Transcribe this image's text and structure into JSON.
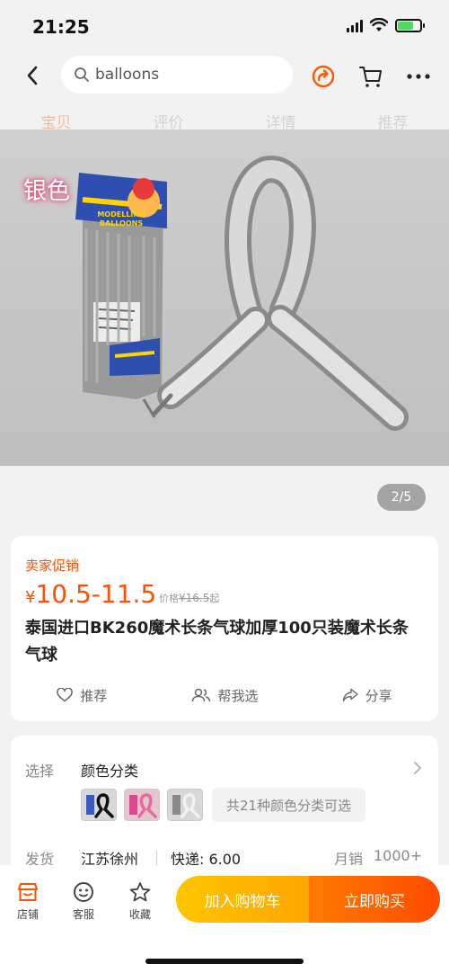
{
  "status_bar": {
    "time": "21:25",
    "battery_level": 0.7
  },
  "search": {
    "query": "balloons"
  },
  "tabs": [
    {
      "label": "宝贝",
      "active": true
    },
    {
      "label": "评价",
      "active": false
    },
    {
      "label": "详情",
      "active": false
    },
    {
      "label": "推荐",
      "active": false
    }
  ],
  "product_image": {
    "overlay_label": "银色",
    "package_brand": "MODELLING BALLOONS",
    "page_indicator": "2/5"
  },
  "product": {
    "promo_label": "卖家促销",
    "currency": "¥",
    "price_range": "10.5-11.5",
    "orig_price_prefix": "价格",
    "orig_price": "¥16.5",
    "orig_price_suffix": "起",
    "title": "泰国进口BK260魔术长条气球加厚100只装魔术长条气球"
  },
  "actions": [
    {
      "label": "推荐",
      "icon": "heart-icon"
    },
    {
      "label": "帮我选",
      "icon": "users-icon"
    },
    {
      "label": "分享",
      "icon": "share-icon"
    }
  ],
  "spec": {
    "select_label": "选择",
    "select_value": "颜色分类",
    "more_colors": "共21种颜色分类可选",
    "ship_label": "发货",
    "ship_from": "江苏徐州",
    "ship_fee": "快递: 6.00",
    "sales_label": "月销",
    "sales_value": "1000+"
  },
  "bottom_bar": {
    "store": "店铺",
    "service": "客服",
    "favorite": "收藏",
    "add_to_cart": "加入购物车",
    "buy_now": "立即购买"
  },
  "colors": {
    "accent": "#ff5000",
    "cart_btn": "#ffb300",
    "buy_btn": "#ff5a00"
  }
}
